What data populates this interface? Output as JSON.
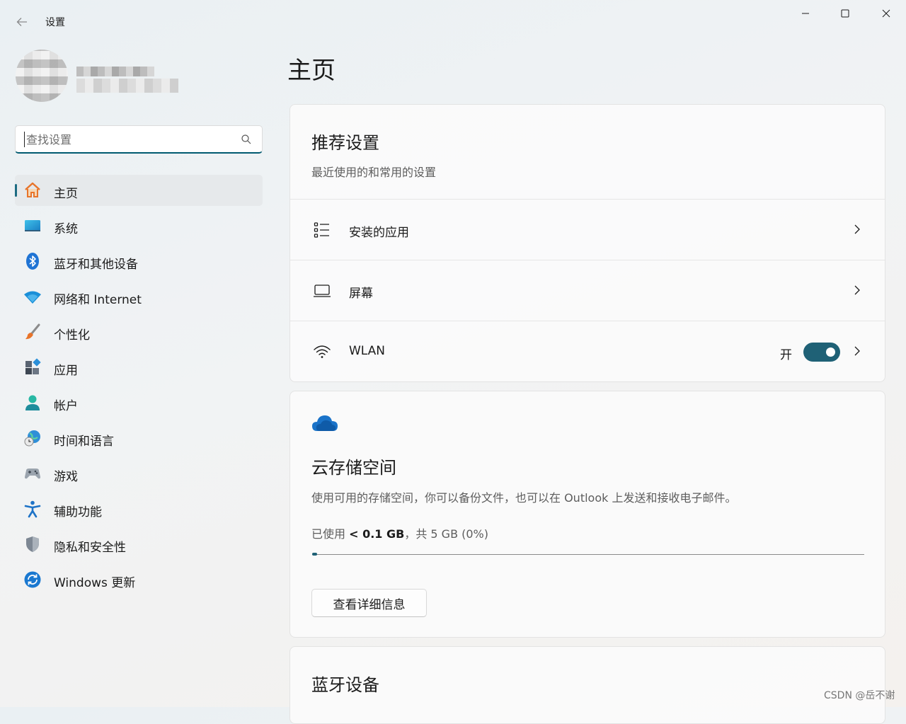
{
  "app": {
    "title": "设置"
  },
  "search": {
    "placeholder": "查找设置"
  },
  "nav": {
    "items": [
      {
        "label": "主页",
        "icon": "home-icon",
        "active": true
      },
      {
        "label": "系统",
        "icon": "system-icon"
      },
      {
        "label": "蓝牙和其他设备",
        "icon": "bluetooth-icon"
      },
      {
        "label": "网络和 Internet",
        "icon": "wifi-icon"
      },
      {
        "label": "个性化",
        "icon": "brush-icon"
      },
      {
        "label": "应用",
        "icon": "apps-icon"
      },
      {
        "label": "帐户",
        "icon": "account-icon"
      },
      {
        "label": "时间和语言",
        "icon": "time-language-icon"
      },
      {
        "label": "游戏",
        "icon": "gamepad-icon"
      },
      {
        "label": "辅助功能",
        "icon": "accessibility-icon"
      },
      {
        "label": "隐私和安全性",
        "icon": "shield-icon"
      },
      {
        "label": "Windows 更新",
        "icon": "update-icon"
      }
    ]
  },
  "main": {
    "title": "主页",
    "recommended": {
      "title": "推荐设置",
      "subtitle": "最近使用的和常用的设置",
      "rows": [
        {
          "label": "安装的应用",
          "icon": "list-icon"
        },
        {
          "label": "屏幕",
          "icon": "laptop-icon"
        },
        {
          "label": "WLAN",
          "icon": "wifi-icon",
          "toggle_label": "开",
          "toggle_on": true
        }
      ]
    },
    "cloud": {
      "icon": "cloud-icon",
      "title": "云存储空间",
      "description": "使用可用的存储空间，你可以备份文件，也可以在 Outlook 上发送和接收电子邮件。",
      "usage_prefix": "已使用 ",
      "usage_amount": "< 0.1 GB",
      "usage_suffix": "，共 5 GB (0%)",
      "usage_fraction": 0.0,
      "button_label": "查看详细信息"
    },
    "bluetooth": {
      "title": "蓝牙设备"
    }
  },
  "watermark": "CSDN @岳不谢",
  "colors": {
    "accent": "#1f6176",
    "home_icon": "#e8742a",
    "cloud_icon": "#1a73c9"
  }
}
